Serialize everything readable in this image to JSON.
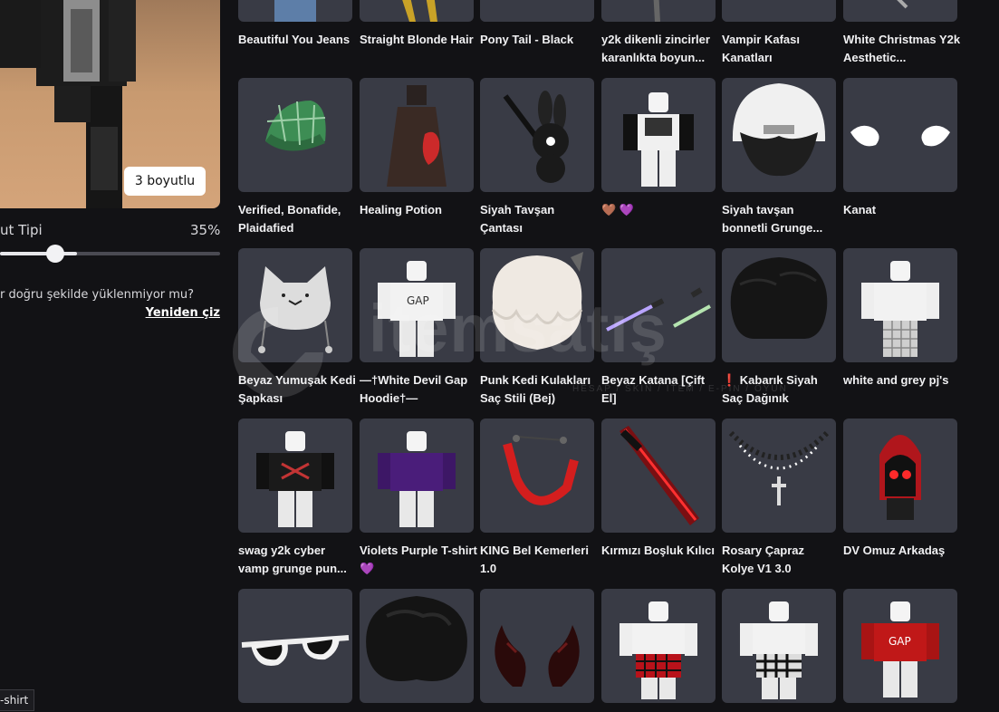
{
  "avatar": {
    "view_button": "3 boyutlu"
  },
  "body_type": {
    "label": "ut Tipi",
    "value_text": "35%",
    "value": 0.35
  },
  "help": {
    "text": "r doğru şekilde yüklenmiyor mu?",
    "redraw": "Yeniden çiz"
  },
  "tooltip": "-shirt",
  "watermark": {
    "brand": "itemsatış",
    "tagline": "HESAP / SKIN / ITEM / E-PIN / OYUN"
  },
  "items": [
    {
      "name": "Beautiful You Jeans",
      "icon": "jeans-icon"
    },
    {
      "name": "Straight Blonde Hair",
      "icon": "blonde-hair-icon"
    },
    {
      "name": "Pony Tail - Black",
      "icon": "ponytail-icon"
    },
    {
      "name": "y2k dikenli zincirler karanlıkta boyun...",
      "icon": "chain-icon"
    },
    {
      "name": "Vampir Kafası Kanatları",
      "icon": "wings-icon"
    },
    {
      "name": "White Christmas Y2k Aesthetic...",
      "icon": "shirt-icon"
    },
    {
      "name": "Verified, Bonafide, Plaidafied",
      "icon": "plaid-cap-icon"
    },
    {
      "name": "Healing Potion",
      "icon": "potion-icon"
    },
    {
      "name": "Siyah Tavşan Çantası",
      "icon": "bunny-bag-icon"
    },
    {
      "name": "🤎 💜",
      "icon": "avatar-shirt-icon"
    },
    {
      "name": "Siyah tavşan bonnetli Grunge...",
      "icon": "beanie-hair-icon"
    },
    {
      "name": "Kanat",
      "icon": "angel-wings-icon"
    },
    {
      "name": "Beyaz Yumuşak Kedi Şapkası",
      "icon": "cat-hat-icon"
    },
    {
      "name": "—†White Devil Gap Hoodie†—",
      "icon": "hoodie-icon"
    },
    {
      "name": "Punk Kedi Kulakları Saç Stili (Bej)",
      "icon": "cat-ear-hair-icon"
    },
    {
      "name": "Beyaz Katana [Çift El]",
      "icon": "katana-icon"
    },
    {
      "name": "❗ Kabarık Siyah Saç Dağınık",
      "icon": "messy-hair-icon"
    },
    {
      "name": "white and grey pj's",
      "icon": "pajama-icon"
    },
    {
      "name": "swag y2k cyber vamp grunge pun...",
      "icon": "grunge-shirt-icon"
    },
    {
      "name": "Violets Purple T-shirt 💜",
      "icon": "purple-shirt-icon"
    },
    {
      "name": "KING Bel Kemerleri 1.0",
      "icon": "belt-icon"
    },
    {
      "name": "Kırmızı Boşluk Kılıcı",
      "icon": "red-sword-icon"
    },
    {
      "name": "Rosary Çapraz Kolye V1 3.0",
      "icon": "rosary-icon"
    },
    {
      "name": "DV Omuz Arkadaş",
      "icon": "shoulder-pal-icon"
    },
    {
      "name": "",
      "icon": "sunglasses-icon"
    },
    {
      "name": "",
      "icon": "black-hair-icon"
    },
    {
      "name": "",
      "icon": "horns-icon"
    },
    {
      "name": "",
      "icon": "red-plaid-skirt-icon"
    },
    {
      "name": "",
      "icon": "black-white-skirt-icon"
    },
    {
      "name": "",
      "icon": "red-shirt-icon"
    }
  ]
}
